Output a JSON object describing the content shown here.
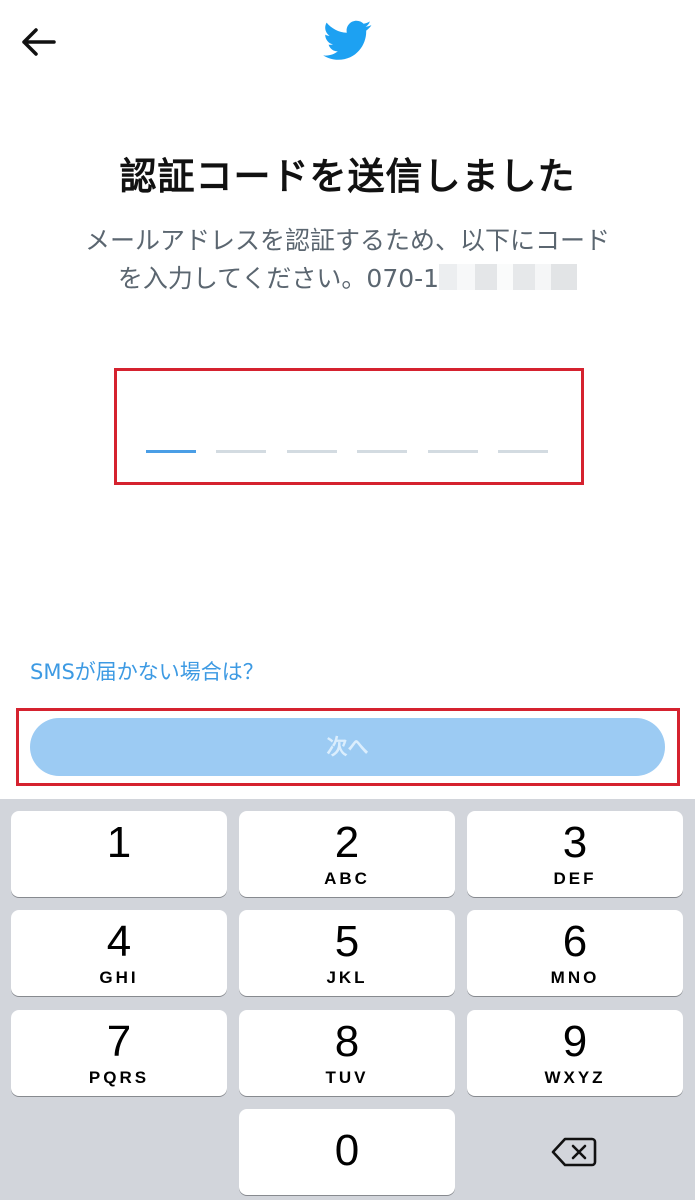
{
  "header": {
    "back_icon": "arrow-left-icon",
    "logo_icon": "twitter-bird-icon",
    "brand_color": "#1da1f2"
  },
  "main": {
    "title": "認証コードを送信しました",
    "description_line1": "メールアドレスを認証するため、以下にコード",
    "description_line2": "を入力してください。070-1",
    "code_input": {
      "digit_count": 6,
      "filled_digits": 0,
      "active_digit": 1,
      "value": ""
    },
    "sms_link": "SMSが届かない場合は？",
    "next_button": "次へ",
    "next_button_enabled": false,
    "highlight_color": "#d5222f"
  },
  "keyboard": {
    "keys": [
      {
        "num": "1",
        "letters": ""
      },
      {
        "num": "2",
        "letters": "ABC"
      },
      {
        "num": "3",
        "letters": "DEF"
      },
      {
        "num": "4",
        "letters": "GHI"
      },
      {
        "num": "5",
        "letters": "JKL"
      },
      {
        "num": "6",
        "letters": "MNO"
      },
      {
        "num": "7",
        "letters": "PQRS"
      },
      {
        "num": "8",
        "letters": "TUV"
      },
      {
        "num": "9",
        "letters": "WXYZ"
      },
      {
        "num": "0",
        "letters": ""
      }
    ],
    "delete_icon": "backspace-icon"
  }
}
